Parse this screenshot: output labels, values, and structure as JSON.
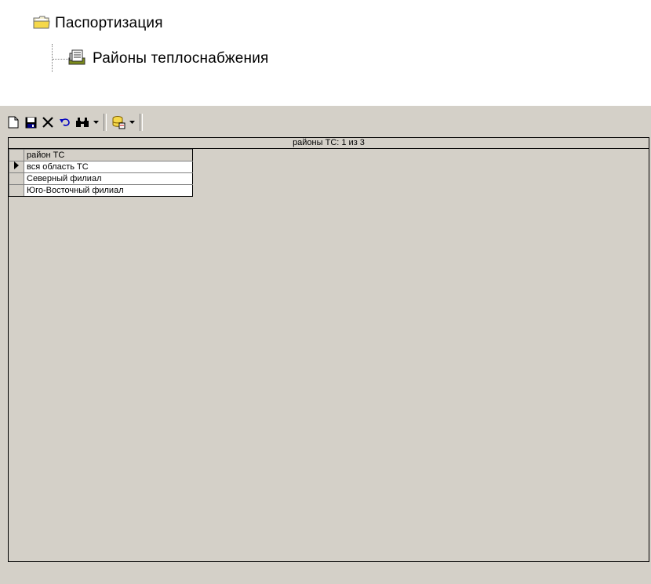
{
  "tree": {
    "root_label": "Паспортизация",
    "child_label": "Районы теплоснабжения"
  },
  "toolbar": {
    "buttons": [
      {
        "name": "new-document-icon"
      },
      {
        "name": "save-icon"
      },
      {
        "name": "delete-icon"
      },
      {
        "name": "undo-icon"
      },
      {
        "name": "find-binoculars-icon"
      },
      {
        "name": "database-icon"
      }
    ]
  },
  "grid": {
    "caption": "районы ТС: 1 из 3",
    "column_header": "район ТС",
    "rows": [
      "вся область ТС",
      "Северный филиал",
      "Юго-Восточный филиал"
    ],
    "selected_row_index": 0
  },
  "colors": {
    "panel_bg": "#d4d0c8",
    "folder_yellow": "#f5d84a",
    "record_green": "#6b7b1f"
  }
}
